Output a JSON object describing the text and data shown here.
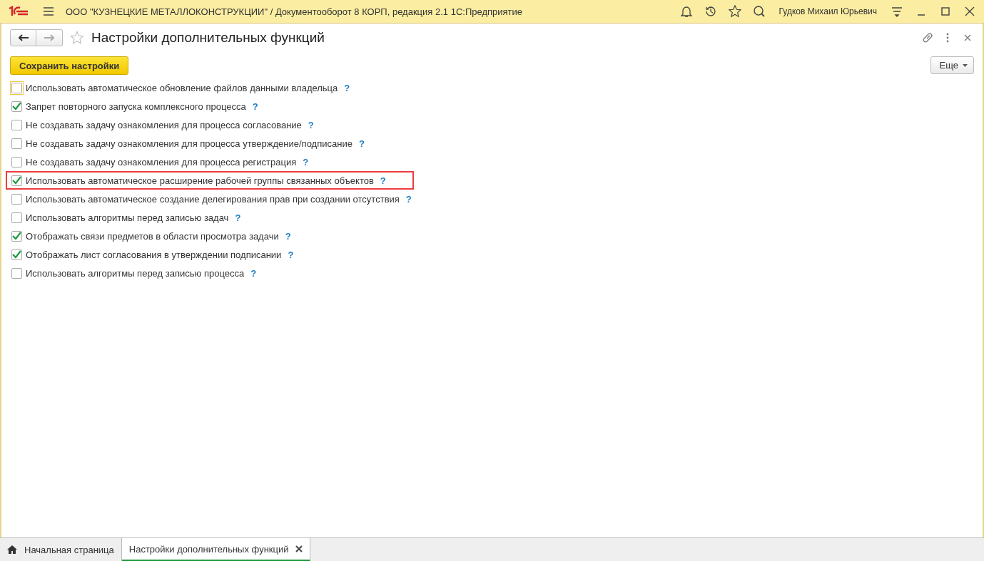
{
  "window": {
    "title": "ООО \"КУЗНЕЦКИЕ МЕТАЛЛОКОНСТРУКЦИИ\" / Документооборот 8 КОРП, редакция 2.1 1С:Предприятие",
    "user": "Гудков Михаил Юрьевич"
  },
  "form": {
    "title": "Настройки дополнительных функций",
    "save_button": "Сохранить настройки",
    "more_button": "Еще",
    "options": [
      {
        "label": "Использовать автоматическое обновление файлов данными владельца",
        "help": "?",
        "checked": false,
        "focused": true,
        "highlighted": false
      },
      {
        "label": "Запрет повторного запуска комплексного процесса",
        "help": "?",
        "checked": true,
        "focused": false,
        "highlighted": false
      },
      {
        "label": "Не создавать задачу ознакомления для процесса согласование",
        "help": "?",
        "checked": false,
        "focused": false,
        "highlighted": false
      },
      {
        "label": "Не создавать задачу ознакомления для процесса утверждение/подписание",
        "help": "?",
        "checked": false,
        "focused": false,
        "highlighted": false
      },
      {
        "label": "Не создавать задачу ознакомления для процесса регистрация",
        "help": "?",
        "checked": false,
        "focused": false,
        "highlighted": false
      },
      {
        "label": "Использовать автоматическое расширение рабочей группы связанных объектов",
        "help": "?",
        "checked": true,
        "focused": false,
        "highlighted": true
      },
      {
        "label": "Использовать автоматическое создание делегирования прав при создании отсутствия",
        "help": "?",
        "checked": false,
        "focused": false,
        "highlighted": false
      },
      {
        "label": "Использовать алгоритмы перед записью задач",
        "help": "?",
        "checked": false,
        "focused": false,
        "highlighted": false
      },
      {
        "label": "Отображать связи предметов в области просмотра задачи",
        "help": "?",
        "checked": true,
        "focused": false,
        "highlighted": false
      },
      {
        "label": "Отображать лист согласования в утверждении подписании",
        "help": "?",
        "checked": true,
        "focused": false,
        "highlighted": false
      },
      {
        "label": "Использовать алгоритмы перед записью процесса",
        "help": "?",
        "checked": false,
        "focused": false,
        "highlighted": false
      }
    ]
  },
  "tabs": [
    {
      "label": "Начальная страница",
      "kind": "home",
      "selected": false
    },
    {
      "label": "Настройки дополнительных функций",
      "kind": "page",
      "selected": true
    }
  ]
}
